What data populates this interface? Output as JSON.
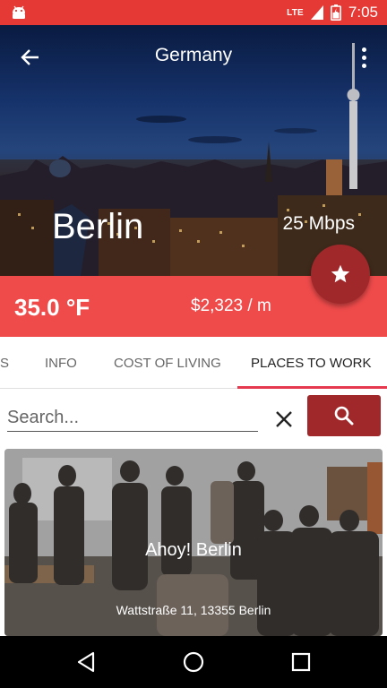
{
  "status_bar": {
    "network_label": "LTE",
    "time": "7:05"
  },
  "toolbar": {
    "title": "Germany"
  },
  "hero": {
    "city": "Berlin",
    "internet_speed": "25 Mbps"
  },
  "info_strip": {
    "temperature": "35.0 °F",
    "cost": "$2,323 / m"
  },
  "tabs": [
    {
      "label": "S"
    },
    {
      "label": "INFO"
    },
    {
      "label": "COST OF LIVING"
    },
    {
      "label": "PLACES TO WORK"
    }
  ],
  "active_tab": "PLACES TO WORK",
  "search": {
    "placeholder": "Search...",
    "value": ""
  },
  "places": [
    {
      "name": "Ahoy! Berlin",
      "address": "Wattstraße 11, 13355 Berlin"
    }
  ],
  "colors": {
    "accent": "#e53935",
    "strip": "#f04b4b",
    "fab": "#a0282a",
    "tab_indicator": "#e53950"
  },
  "icons": {
    "back": "arrow-left-icon",
    "overflow": "more-vert-icon",
    "favorite": "star-icon",
    "clear": "close-icon",
    "search": "search-icon",
    "nav_back": "triangle-back-icon",
    "nav_home": "circle-home-icon",
    "nav_recents": "square-recents-icon"
  }
}
